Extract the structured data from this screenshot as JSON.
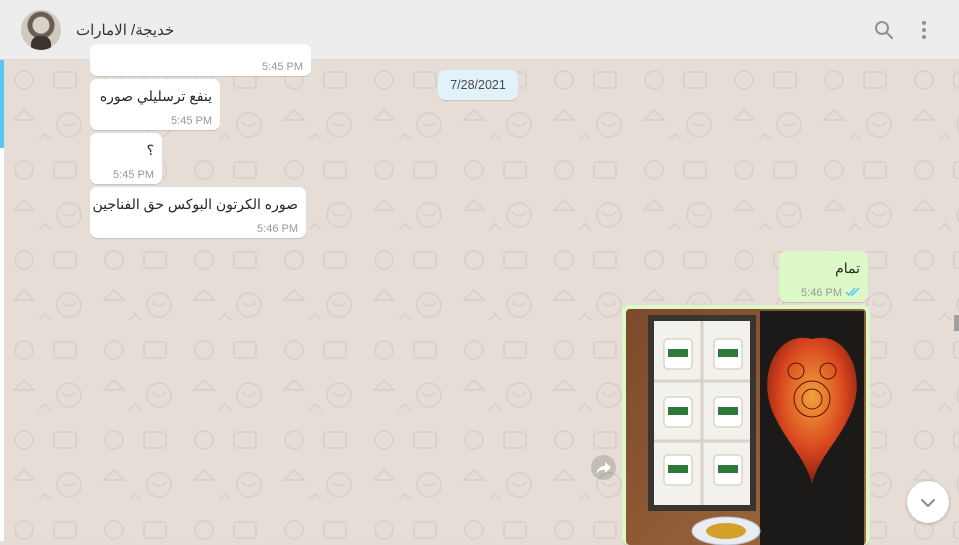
{
  "header": {
    "contact_name": "خديجة/ الامارات"
  },
  "date_chip": "7/28/2021",
  "messages_in": [
    {
      "text": "",
      "time": "5:45 PM"
    },
    {
      "text": "ينفع ترسليلي صوره",
      "time": "5:45 PM"
    },
    {
      "text": "؟",
      "time": "5:45 PM"
    },
    {
      "text": "صوره الكرتون البوكس حق الفناجين",
      "time": "5:46 PM"
    }
  ],
  "messages_out": [
    {
      "text": "تمام",
      "time": "5:46 PM",
      "status": "read-double-tick"
    }
  ],
  "colors": {
    "header_bg": "#ededed",
    "chat_bg": "#e6ded6",
    "incoming_bubble": "#ffffff",
    "outgoing_bubble": "#dcf8c6",
    "read_tick": "#4fc3f7",
    "date_chip_bg": "#e1f2fb"
  },
  "icons": [
    "search-icon",
    "menu-dots-icon",
    "forward-icon",
    "chevron-down-icon",
    "double-check-icon"
  ]
}
